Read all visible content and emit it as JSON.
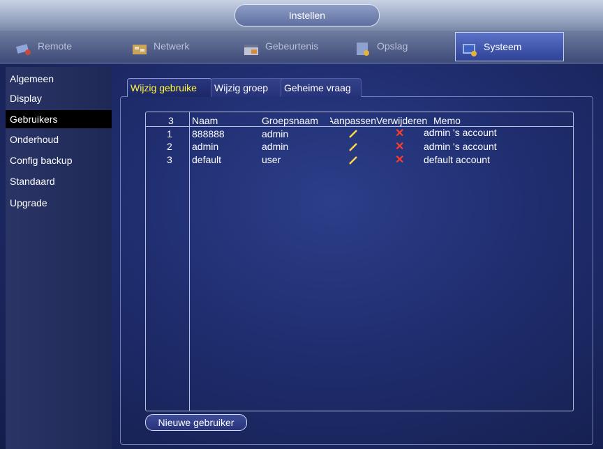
{
  "window": {
    "title": "Instellen"
  },
  "main_tabs": [
    {
      "label": "Remote",
      "icon": "remote-icon"
    },
    {
      "label": "Netwerk",
      "icon": "network-icon"
    },
    {
      "label": "Gebeurtenis",
      "icon": "event-icon"
    },
    {
      "label": "Opslag",
      "icon": "storage-icon"
    },
    {
      "label": "Systeem",
      "icon": "system-icon",
      "active": true
    }
  ],
  "sidebar": {
    "items": [
      {
        "label": "Algemeen"
      },
      {
        "label": "Display"
      },
      {
        "label": "Gebruikers",
        "active": true
      },
      {
        "label": "Onderhoud"
      },
      {
        "label": "Config backup"
      },
      {
        "label": "Standaard"
      },
      {
        "label": "Upgrade"
      }
    ]
  },
  "sub_tabs": [
    {
      "label": "Wijzig gebruike",
      "active": true
    },
    {
      "label": "Wijzig groep"
    },
    {
      "label": "Geheime vraag"
    }
  ],
  "table": {
    "count": "3",
    "headers": {
      "name": "Naam",
      "group": "Groepsnaam",
      "edit": "Aanpassen",
      "delete": "Verwijderen",
      "memo": "Memo"
    },
    "rows": [
      {
        "index": "1",
        "name": "888888",
        "group": "admin",
        "memo": "admin 's account"
      },
      {
        "index": "2",
        "name": "admin",
        "group": "admin",
        "memo": "admin 's account"
      },
      {
        "index": "3",
        "name": "default",
        "group": "user",
        "memo": "default account"
      }
    ]
  },
  "buttons": {
    "new_user": "Nieuwe gebruiker"
  },
  "colors": {
    "active_subtab_text": "#fff43a",
    "delete_icon": "#ff3b2a",
    "edit_icon": "#ffd84a"
  }
}
